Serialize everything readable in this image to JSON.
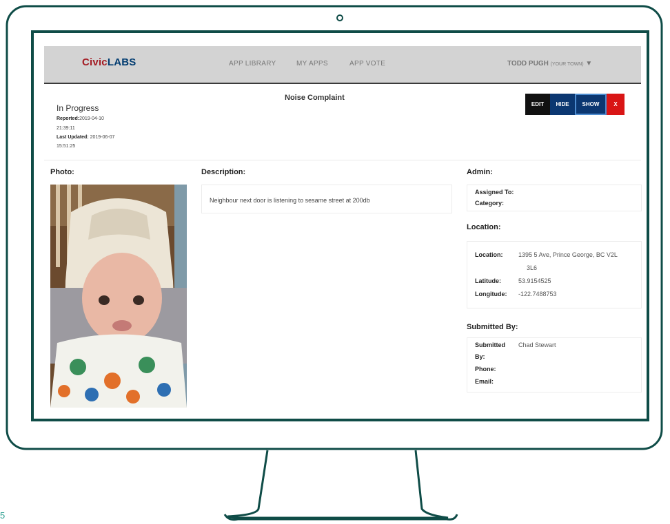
{
  "nav": {
    "logo_civic": "Civic",
    "logo_labs": "LABS",
    "links": [
      "APP LIBRARY",
      "MY APPS",
      "APP VOTE"
    ],
    "user_name": "TODD PUGH",
    "user_town": "(YOUR TOWN)",
    "user_caret": "▼"
  },
  "report": {
    "title": "Noise Complaint",
    "status": "In Progress",
    "reported_label": "Reported:",
    "reported_date": "2019-04-10",
    "reported_time": "21:39:11",
    "updated_label": "Last Updated:",
    "updated_date": "2019-06-07",
    "updated_time": "15:51:25"
  },
  "actions": {
    "edit": "EDIT",
    "hide": "HIDE",
    "show": "SHOW",
    "close": "X"
  },
  "photo": {
    "label": "Photo:"
  },
  "description": {
    "label": "Description:",
    "text": "Neighbour next door is listening to sesame street at 200db"
  },
  "admin": {
    "label": "Admin:",
    "assigned_label": "Assigned To:",
    "category_label": "Category:"
  },
  "location": {
    "label": "Location:",
    "location_label": "Location:",
    "location_line1": "1395 5 Ave, Prince George, BC V2L",
    "location_line2": "3L6",
    "latitude_label": "Latitude:",
    "latitude": "53.9154525",
    "longitude_label": "Longitude:",
    "longitude": "-122.7488753"
  },
  "submitted": {
    "label": "Submitted By:",
    "by_label_1": "Submitted",
    "by_label_2": "By:",
    "by_value": "Chad Stewart",
    "phone_label": "Phone:",
    "email_label": "Email:"
  },
  "corner_number": "5",
  "colors": {
    "frame": "#0f4c47",
    "navbar": "#d3d3d3",
    "show_button": "#0b3771",
    "close_button": "#d91515"
  }
}
